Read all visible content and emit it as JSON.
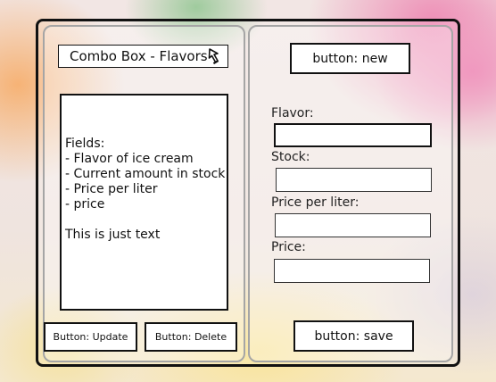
{
  "left_panel": {
    "combo_label": "Combo Box - Flavors",
    "info_text": "Fields:\n- Flavor of ice cream\n- Current amount in stock\n- Price per liter\n- price\n\nThis is just text",
    "update_button": "Button: Update",
    "delete_button": "Button: Delete"
  },
  "right_panel": {
    "new_button": "button: new",
    "flavor_label": "Flavor:",
    "flavor_value": "",
    "stock_label": "Stock:",
    "stock_value": "",
    "price_per_liter_label": "Price per liter:",
    "price_per_liter_value": "",
    "price_label": "Price:",
    "price_value": "",
    "save_button": "button: save"
  }
}
